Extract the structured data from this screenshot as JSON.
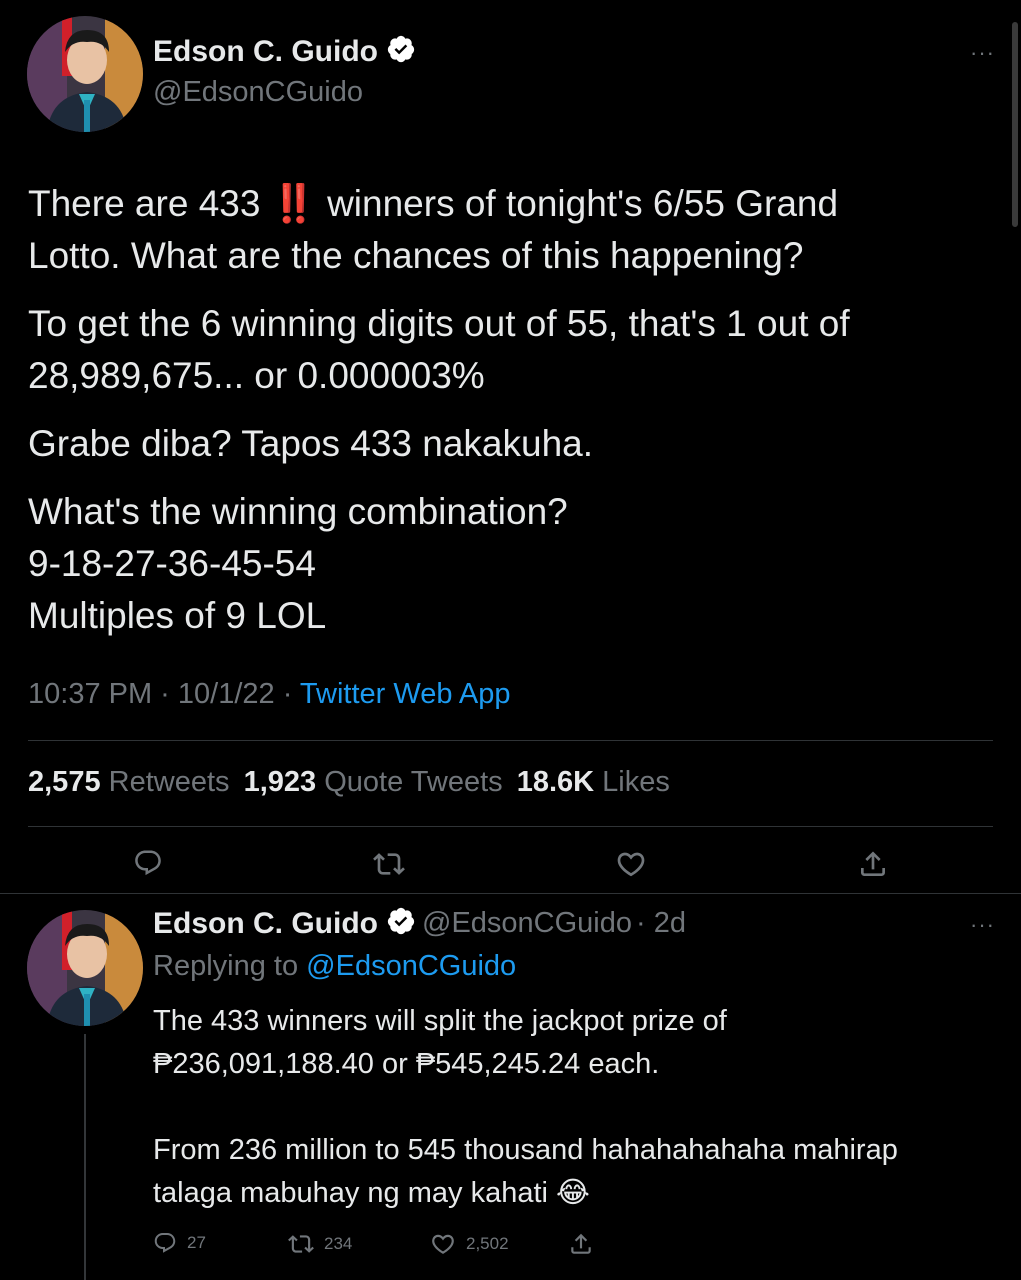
{
  "tweet": {
    "author_name": "Edson C. Guido",
    "author_handle": "@EdsonCGuido",
    "more_label": "···",
    "line1_pre": "There are 433",
    "line1_emoji": "‼️",
    "line1_post": "winners of tonight's 6/55 Grand",
    "line2": "Lotto. What are the chances of this happening?",
    "para2_line1": "To get the 6 winning digits out of 55, that's 1 out of",
    "para2_line2": "28,989,675... or 0.000003%",
    "para3": "Grabe diba? Tapos 433 nakakuha.",
    "para4_line1": "What's the winning combination?",
    "para4_line2": "9-18-27-36-45-54",
    "para4_line3": "Multiples of 9 LOL",
    "time": "10:37 PM · 10/1/22 · ",
    "source": "Twitter Web App",
    "retweets_count": "2,575",
    "retweets_label": "Retweets",
    "quotes_count": "1,923",
    "quotes_label": "Quote Tweets",
    "likes_count": "18.6K",
    "likes_label": "Likes"
  },
  "reply": {
    "author_name": "Edson C. Guido",
    "author_handle": "@EdsonCGuido",
    "age": "· 2d",
    "more_label": "···",
    "replying_prefix": "Replying to",
    "replying_handle": "@EdsonCGuido",
    "line1": "The 433 winners will split the jackpot prize of",
    "line2": "₱236,091,188.40 or ₱545,245.24 each.",
    "line3": "From 236 million to 545 thousand hahahahahaha mahirap",
    "line4_pre": "talaga mabuhay ng may kahati",
    "line4_emoji": "😂",
    "reply_count": "27",
    "retweet_count": "234",
    "like_count": "2,502"
  },
  "colors": {
    "background": "#000000",
    "text": "#e7e9ea",
    "secondary": "#71767b",
    "link": "#1d9bf0",
    "divider": "#2f3336",
    "verified": "#ffffff"
  },
  "icons": [
    "verified-badge-icon",
    "more-icon",
    "reply-icon",
    "retweet-icon",
    "like-icon",
    "share-icon",
    "red-double-exclamation-icon",
    "laughing-emoji-icon"
  ]
}
